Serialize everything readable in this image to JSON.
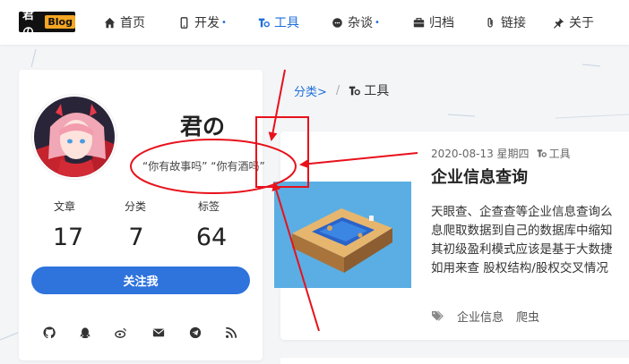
{
  "logo": {
    "char": "君の",
    "blog": "Blog"
  },
  "nav": {
    "items": [
      {
        "label": "首页",
        "icon": "home-icon",
        "dot": ""
      },
      {
        "label": "开发",
        "icon": "mobile-icon",
        "dot": "•"
      },
      {
        "label": "工具",
        "icon": "tools-icon",
        "dot": "",
        "active": true
      },
      {
        "label": "杂谈",
        "icon": "chat-icon",
        "dot": "•"
      },
      {
        "label": "归档",
        "icon": "archive-icon",
        "dot": ""
      },
      {
        "label": "链接",
        "icon": "paperclip-icon",
        "dot": ""
      },
      {
        "label": "关于",
        "icon": "pin-icon",
        "dot": ""
      }
    ]
  },
  "profile": {
    "name": "君の",
    "motto": "“你有故事吗”  “你有酒吗”",
    "stats": [
      {
        "label": "文章",
        "value": "17"
      },
      {
        "label": "分类",
        "value": "7"
      },
      {
        "label": "标签",
        "value": "64"
      }
    ],
    "follow_label": "关注我",
    "social": [
      "github-icon",
      "qq-icon",
      "weibo-icon",
      "mail-icon",
      "telegram-icon",
      "rss-icon"
    ]
  },
  "breadcrumb": {
    "parent": "分类>",
    "separator": "/",
    "current": "工具"
  },
  "article": {
    "date": "2020-08-13 星期四",
    "category": "工具",
    "title": "企业信息查询",
    "excerpt": [
      "天眼查、企查查等企业信息查询么",
      "息爬取数据到自己的数据库中缩知",
      "其初级盈利模式应该是基于大数捷",
      "如用来查 股权结构/股权交叉情况"
    ],
    "tags": [
      "企业信息",
      "爬虫"
    ]
  },
  "colors": {
    "accent": "#1e6fd9",
    "button": "#2f73dc",
    "annotation": "#e8111b"
  }
}
